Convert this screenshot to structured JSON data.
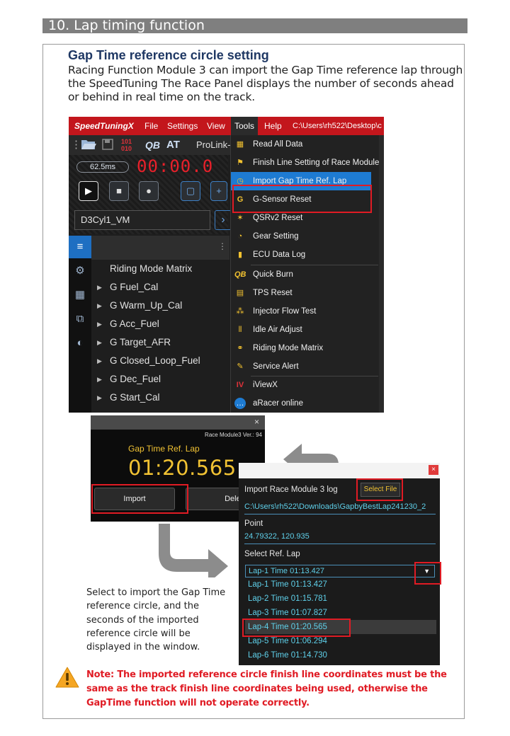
{
  "section": {
    "title": "10. Lap timing function"
  },
  "heading": "Gap Time reference circle setting",
  "intro": "Racing Function Module 3 can import the Gap Time reference lap through the SpeedTuning The Race Panel displays the number of seconds ahead or behind in real time on the track.",
  "app": {
    "brand": "SpeedTuningX",
    "menu": [
      "File",
      "Settings",
      "View",
      "Tools",
      "Help"
    ],
    "path": "C:\\Users\\rh522\\Desktop\\c",
    "toolbar_link": "ProLink-",
    "toolbar_at": "AT",
    "time_chip": "62.5ms",
    "timer": "00:00.0",
    "map_name": "D3Cyl1_VM",
    "tree": [
      "Riding Mode Matrix",
      "G Fuel_Cal",
      "G Warm_Up_Cal",
      "G Acc_Fuel",
      "G Target_AFR",
      "G Closed_Loop_Fuel",
      "G Dec_Fuel",
      "G Start_Cal"
    ],
    "tools_menu": [
      {
        "label": "Read All Data",
        "icon": "grid-icon"
      },
      {
        "label": "Finish Line Setting of Race Module",
        "icon": "flag-icon"
      },
      {
        "label": "Import Gap Time Ref. Lap",
        "icon": "clock-icon"
      },
      {
        "label": "G-Sensor Reset",
        "icon": "g-icon"
      },
      {
        "label": "QSRv2 Reset",
        "icon": "spark-icon"
      },
      {
        "label": "Gear Setting",
        "icon": "gauge-icon"
      },
      {
        "label": "ECU Data Log",
        "icon": "battery-icon"
      },
      {
        "label": "Quick Burn",
        "icon": "qb-icon"
      },
      {
        "label": "TPS Reset",
        "icon": "tps-icon"
      },
      {
        "label": "Injector Flow Test",
        "icon": "drops-icon"
      },
      {
        "label": "Idle Air Adjust",
        "icon": "sliders-icon"
      },
      {
        "label": "Riding Mode Matrix",
        "icon": "bike-icon"
      },
      {
        "label": "Service Alert",
        "icon": "wrench-icon"
      },
      {
        "label": "iViewX",
        "icon": "iv-icon"
      },
      {
        "label": "aRacer online",
        "icon": "chat-icon"
      }
    ]
  },
  "gap_panel": {
    "version": "Race Module3 Ver.: 94",
    "label": "Gap Time Ref. Lap",
    "value": "01:20.565",
    "import_label": "Import",
    "delete_label": "Delete",
    "close": "×"
  },
  "import_dialog": {
    "title": "Import Race Module 3 log",
    "select_file": "Select File",
    "file_path": "C:\\Users\\rh522\\Downloads\\GapbyBestLap241230_2",
    "point_label": "Point",
    "point_value": "24.79322, 120.935",
    "ref_label": "Select Ref. Lap",
    "selected": "Lap-1 Time 01:13.427",
    "laps": [
      "Lap-1 Time 01:13.427",
      "Lap-2 Time 01:15.781",
      "Lap-3 Time 01:07.827",
      "Lap-4 Time 01:20.565",
      "Lap-5 Time 01:06.294",
      "Lap-6 Time 01:14.730"
    ],
    "close": "×"
  },
  "caption": "Select to import the Gap Time reference circle, and the seconds of the imported reference circle will be displayed in the window.",
  "note": "Note: The imported reference circle finish line coordinates must be the same as the track finish line coordinates being used, otherwise the GapTime function will not operate correctly.",
  "colors": {
    "header_bar": "#7f7f7f",
    "title": "#1f3864",
    "note": "#e01b24",
    "menubar": "#c3161c",
    "highlight": "#1e7bd2",
    "gold": "#f1c233",
    "cyan": "#5fd0ea"
  }
}
